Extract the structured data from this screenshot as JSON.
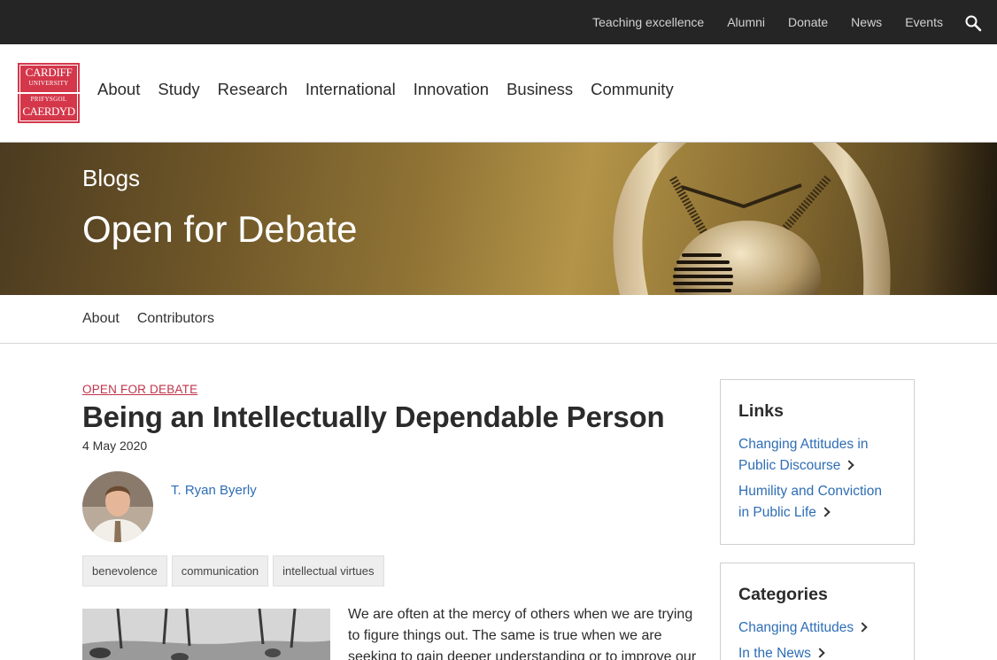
{
  "utility": {
    "links": [
      "Teaching excellence",
      "Alumni",
      "Donate",
      "News",
      "Events"
    ],
    "search_icon": "search-icon"
  },
  "logo": {
    "line1": "CARDIFF",
    "line2": "UNIVERSITY",
    "line3": "PRIFYSGOL",
    "line4": "CAERDYD",
    "color": "#d4374a"
  },
  "nav": {
    "items": [
      "About",
      "Study",
      "Research",
      "International",
      "Innovation",
      "Business",
      "Community"
    ]
  },
  "hero": {
    "supertitle": "Blogs",
    "title": "Open for Debate"
  },
  "subnav": {
    "items": [
      "About",
      "Contributors"
    ]
  },
  "post": {
    "kicker": "OPEN FOR DEBATE",
    "title": "Being an Intellectually Dependable Person",
    "date": "4 May 2020",
    "author": "T. Ryan Byerly",
    "tags": [
      "benevolence",
      "communication",
      "intellectual virtues"
    ],
    "body": "We are often at the mercy of others when we are trying to figure things out. The same is true when we are seeking to gain deeper understanding or to improve our"
  },
  "sidebar": {
    "links": {
      "heading": "Links",
      "items": [
        {
          "label": "Changing Attitudes in Public Discourse"
        },
        {
          "label": "Humility and Conviction in Public Life"
        }
      ]
    },
    "categories": {
      "heading": "Categories",
      "items": [
        {
          "label": "Changing Attitudes"
        },
        {
          "label": "In the News"
        }
      ]
    }
  },
  "colors": {
    "utility_bg": "#252525",
    "accent": "#c1344a",
    "link": "#2e6db5"
  }
}
